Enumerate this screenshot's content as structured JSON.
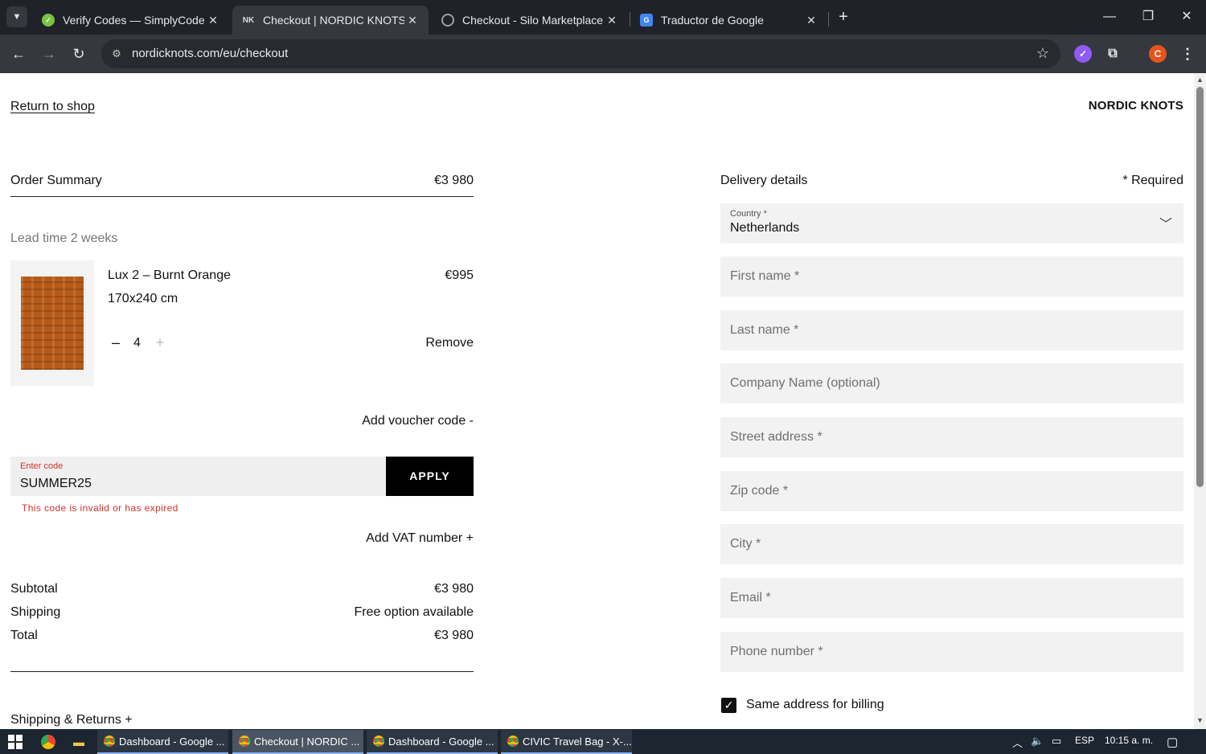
{
  "browser": {
    "tabs": [
      {
        "title": "Verify Codes — SimplyCodes",
        "favicon": "simplycodes-icon",
        "color": "#7cc242"
      },
      {
        "title": "Checkout | NORDIC KNOTS",
        "favicon": "nordicknots-icon",
        "color": "#111111"
      },
      {
        "title": "Checkout - Silo Marketplace",
        "favicon": "globe-icon",
        "color": "#9aa0a6"
      },
      {
        "title": "Traductor de Google",
        "favicon": "google-translate-icon",
        "color": "#4285f4"
      }
    ],
    "new_tab": "+",
    "url": "nordicknots.com/eu/checkout",
    "profile_initial": "C",
    "accent": "#e8531d"
  },
  "header": {
    "return_link": "Return to shop",
    "brand": "NORDIC KNOTS"
  },
  "summary": {
    "title": "Order Summary",
    "total": "€3 980",
    "lead_time": "Lead time 2 weeks",
    "item": {
      "name": "Lux 2 – Burnt Orange",
      "size": "170x240 cm",
      "price": "€995",
      "quantity": "4",
      "minus": "–",
      "plus": "+",
      "remove": "Remove",
      "image": "rug-thumbnail"
    },
    "voucher_toggle": "Add voucher code -",
    "voucher": {
      "label": "Enter code",
      "value": "SUMMER25",
      "apply": "APPLY",
      "error": "This code is invalid or has expired",
      "error_color": "#d0342c"
    },
    "vat_toggle": "Add VAT number +",
    "rows": [
      {
        "label": "Subtotal",
        "value": "€3 980"
      },
      {
        "label": "Shipping",
        "value": "Free option available"
      },
      {
        "label": "Total",
        "value": "€3 980"
      }
    ],
    "shipping_returns": "Shipping & Returns +"
  },
  "delivery": {
    "title": "Delivery details",
    "required": "* Required",
    "country": {
      "label": "Country *",
      "value": "Netherlands"
    },
    "fields": [
      {
        "placeholder": "First name *"
      },
      {
        "placeholder": "Last name *"
      },
      {
        "placeholder": "Company Name (optional)"
      },
      {
        "placeholder": "Street address *"
      },
      {
        "placeholder": "Zip code *"
      },
      {
        "placeholder": "City *"
      },
      {
        "placeholder": "Email *"
      },
      {
        "placeholder": "Phone number *"
      }
    ],
    "same_billing": {
      "label": "Same address for billing",
      "checked": true
    }
  },
  "taskbar": {
    "tasks": [
      {
        "label": "Dashboard - Google ..."
      },
      {
        "label": "Checkout | NORDIC ..."
      },
      {
        "label": "Dashboard - Google ..."
      },
      {
        "label": "CIVIC Travel Bag - X-..."
      }
    ],
    "language": "ESP",
    "time": "10:15 a. m."
  }
}
